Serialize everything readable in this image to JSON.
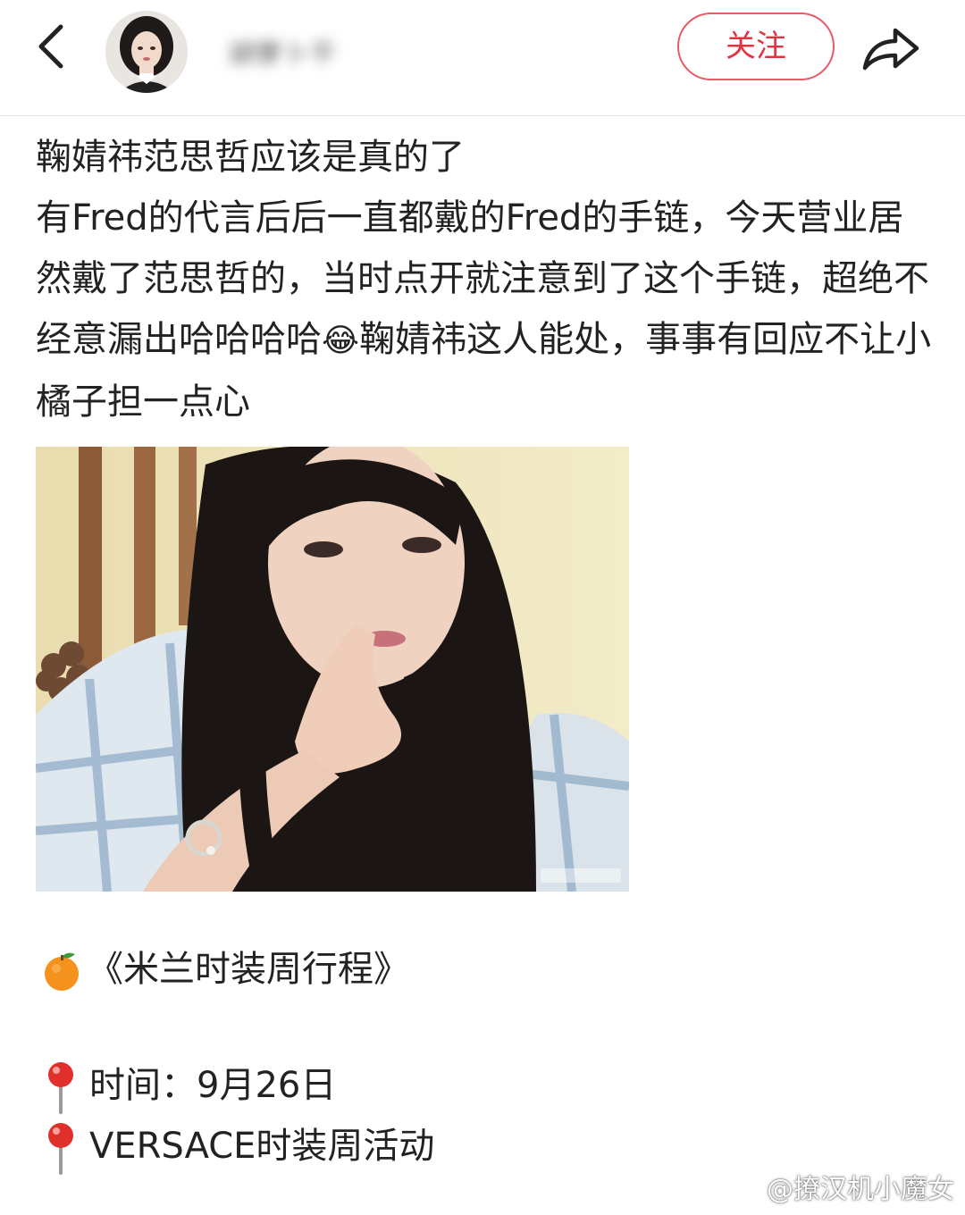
{
  "header": {
    "username": "胡萝卜干",
    "follow_label": "关注",
    "icons": {
      "back": "chevron-left-icon",
      "share": "share-arrow-icon"
    }
  },
  "post": {
    "lines": [
      "鞠婧祎范思哲应该是真的了",
      "有Fred的代言后后一直都戴的Fred的手链，今天营业居然戴了范思哲的，当时点开就注意到了这个手链，超绝不经意漏出哈哈哈哈",
      "鞠婧祎这人能处，事事有回应不让小橘子担一点心"
    ],
    "emoji": "😂"
  },
  "itinerary": {
    "title": "《米兰时装周行程》",
    "time_label": "时间：",
    "time_value": "9月26日",
    "event": "VERSACE时装周活动"
  },
  "watermark": {
    "text": "@撩汉机小魔女"
  },
  "colors": {
    "accent": "#e03441",
    "follow_border": "#e85a66",
    "text": "#222222",
    "divider": "#e6e6e6"
  }
}
